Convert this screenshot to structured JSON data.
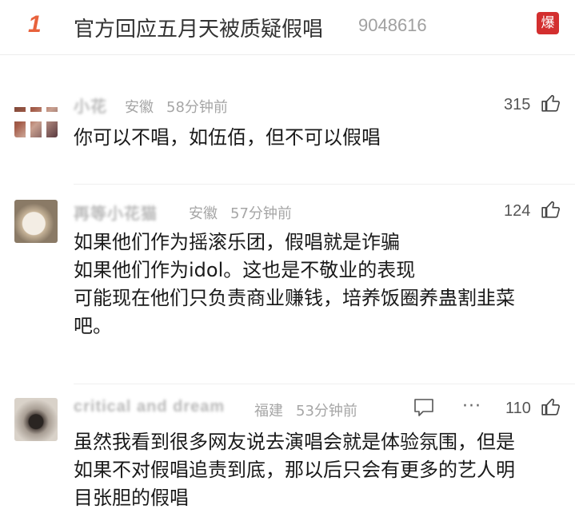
{
  "topic": {
    "rank": "1",
    "title": "官方回应五月天被质疑假唱",
    "heat": "9048616",
    "badge": "爆"
  },
  "comments": [
    {
      "username": "小花",
      "location": "安徽",
      "time": "58分钟前",
      "likes": "315",
      "lines": [
        "你可以不唱，如伍佰，但不可以假唱"
      ]
    },
    {
      "username": "再等小花猫",
      "location": "安徽",
      "time": "57分钟前",
      "likes": "124",
      "lines": [
        "如果他们作为摇滚乐团，假唱就是诈骗",
        "如果他们作为idol。这也是不敬业的表现",
        "可能现在他们只负责商业赚钱，培养饭圈养蛊割韭菜",
        "吧。"
      ]
    },
    {
      "username": "critical and dream",
      "location": "福建",
      "time": "53分钟前",
      "likes": "110",
      "lines": [
        "虽然我看到很多网友说去演唱会就是体验氛围，但是",
        "如果不对假唱追责到底，那以后只会有更多的艺人明",
        "目张胆的假唱"
      ]
    }
  ],
  "icons": {
    "like": "thumbs-up-icon",
    "reply": "comment-bubble-icon",
    "more": "more-dots-icon"
  },
  "colors": {
    "rank": "#e8623c",
    "badge": "#d32f2f"
  }
}
